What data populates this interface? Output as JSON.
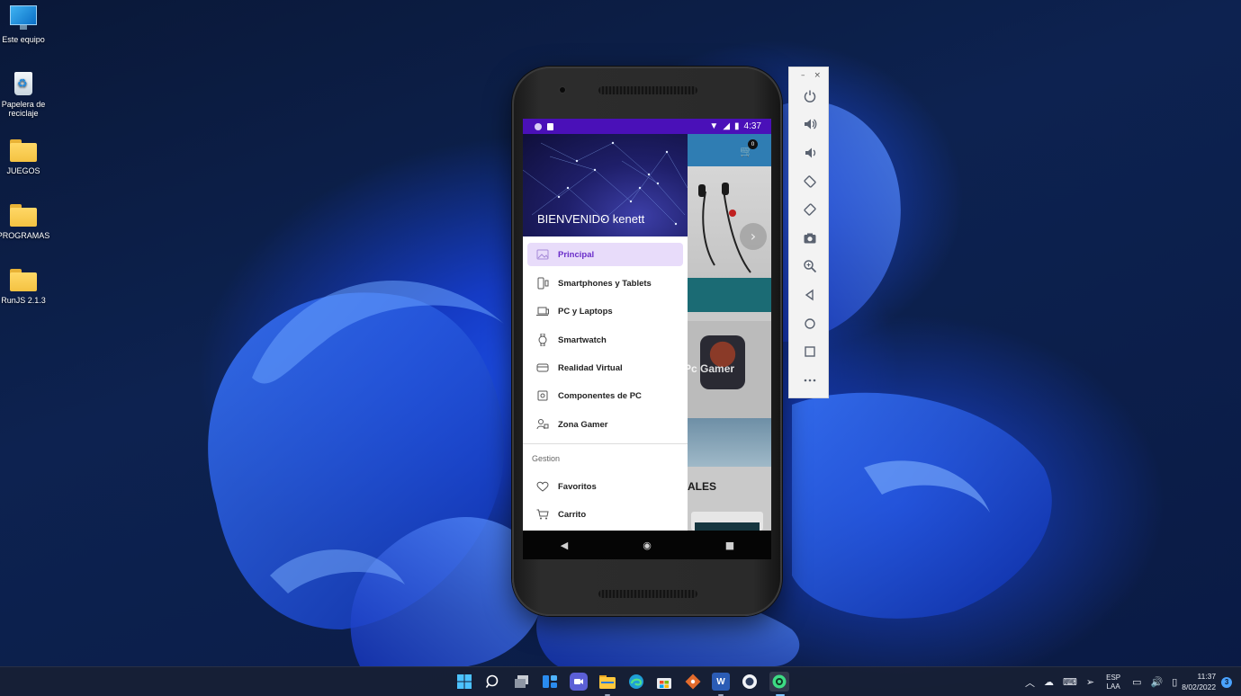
{
  "desktop": {
    "icons": [
      {
        "label": "Este equipo",
        "icon": "monitor-icon"
      },
      {
        "label": "Papelera de reciclaje",
        "icon": "recycle-bin-icon"
      },
      {
        "label": "JUEGOS",
        "icon": "folder-icon"
      },
      {
        "label": "PROGRAMAS",
        "icon": "folder-icon"
      },
      {
        "label": "RunJS 2.1.3",
        "icon": "folder-icon"
      }
    ]
  },
  "phone": {
    "status_bar": {
      "time": "4:37"
    },
    "app": {
      "cart_count": "0",
      "banner_label": "Pc Gamer",
      "section_title": "ALES"
    },
    "drawer": {
      "header_title": "BIENVENIDO kenett",
      "items": [
        {
          "label": "Principal",
          "icon": "gallery-icon",
          "active": true
        },
        {
          "label": "Smartphones y Tablets",
          "icon": "smartphone-icon"
        },
        {
          "label": "PC y Laptops",
          "icon": "laptop-icon"
        },
        {
          "label": "Smartwatch",
          "icon": "watch-icon"
        },
        {
          "label": "Realidad Virtual",
          "icon": "vr-headset-icon"
        },
        {
          "label": "Componentes de PC",
          "icon": "chip-icon"
        },
        {
          "label": "Zona Gamer",
          "icon": "gamer-icon"
        }
      ],
      "group_title": "Gestion",
      "group_items": [
        {
          "label": "Favoritos",
          "icon": "heart-icon"
        },
        {
          "label": "Carrito",
          "icon": "cart-icon"
        }
      ]
    },
    "nav_bar": {
      "back": "◀",
      "home": "◉",
      "recents": "■"
    }
  },
  "emulator_toolbar": {
    "minimize": "–",
    "close": "×",
    "buttons": [
      "power-icon",
      "volume-up-icon",
      "volume-down-icon",
      "rotate-left-icon",
      "rotate-right-icon",
      "camera-icon",
      "zoom-icon",
      "back-icon",
      "home-icon",
      "overview-icon",
      "more-icon"
    ]
  },
  "taskbar": {
    "apps": [
      "start-icon",
      "search-icon",
      "task-view-icon",
      "widgets-icon",
      "chat-icon",
      "file-explorer-icon",
      "edge-icon",
      "store-icon",
      "git-icon",
      "word-icon",
      "app-icon",
      "android-studio-icon"
    ],
    "language": {
      "line1": "ESP",
      "line2": "LAA"
    },
    "time": "11:37",
    "date": "8/02/2022",
    "notifications": "3"
  },
  "colors": {
    "status_bar": "#4a10b8",
    "active_item_bg": "#e8dcfa",
    "active_item_text": "#6a2dc9",
    "toolbar": "#2f7db3"
  }
}
